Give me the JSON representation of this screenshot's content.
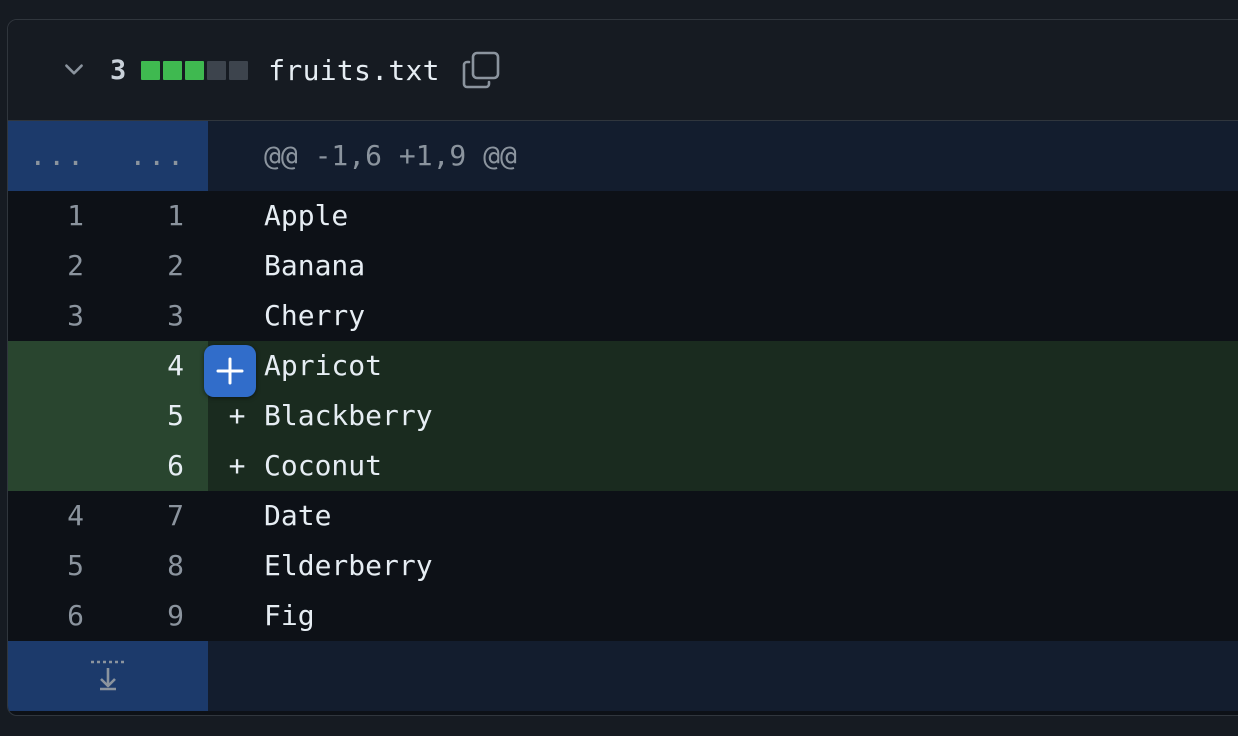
{
  "file": {
    "collapse_icon": "chevron-down-icon",
    "changes_count": "3",
    "diffstat_colors": [
      "#3fb950",
      "#3fb950",
      "#3fb950",
      "#3d444d",
      "#3d444d"
    ],
    "filename": "fruits.txt",
    "copy_icon": "copy-icon"
  },
  "hunk": {
    "old_expander": "...",
    "new_expander": "...",
    "header": "@@ -1,6 +1,9 @@"
  },
  "lines": [
    {
      "old": "1",
      "new": "1",
      "marker": "",
      "text": "Apple",
      "type": "context"
    },
    {
      "old": "2",
      "new": "2",
      "marker": "",
      "text": "Banana",
      "type": "context"
    },
    {
      "old": "3",
      "new": "3",
      "marker": "",
      "text": "Cherry",
      "type": "context"
    },
    {
      "old": "",
      "new": "4",
      "marker": "+",
      "text": "Apricot",
      "type": "added"
    },
    {
      "old": "",
      "new": "5",
      "marker": "+",
      "text": "Blackberry",
      "type": "added"
    },
    {
      "old": "",
      "new": "6",
      "marker": "+",
      "text": "Coconut",
      "type": "added"
    },
    {
      "old": "4",
      "new": "7",
      "marker": "",
      "text": "Date",
      "type": "context"
    },
    {
      "old": "5",
      "new": "8",
      "marker": "",
      "text": "Elderberry",
      "type": "context"
    },
    {
      "old": "6",
      "new": "9",
      "marker": "",
      "text": "Fig",
      "type": "context"
    }
  ],
  "add_comment_icon": "plus-icon",
  "expand_icon": "expand-down-icon",
  "colors": {
    "accent": "#316dca",
    "added_bg": "#1a2b1f",
    "added_gutter": "#29452f",
    "hunk_gutter": "#1c3a6b"
  }
}
